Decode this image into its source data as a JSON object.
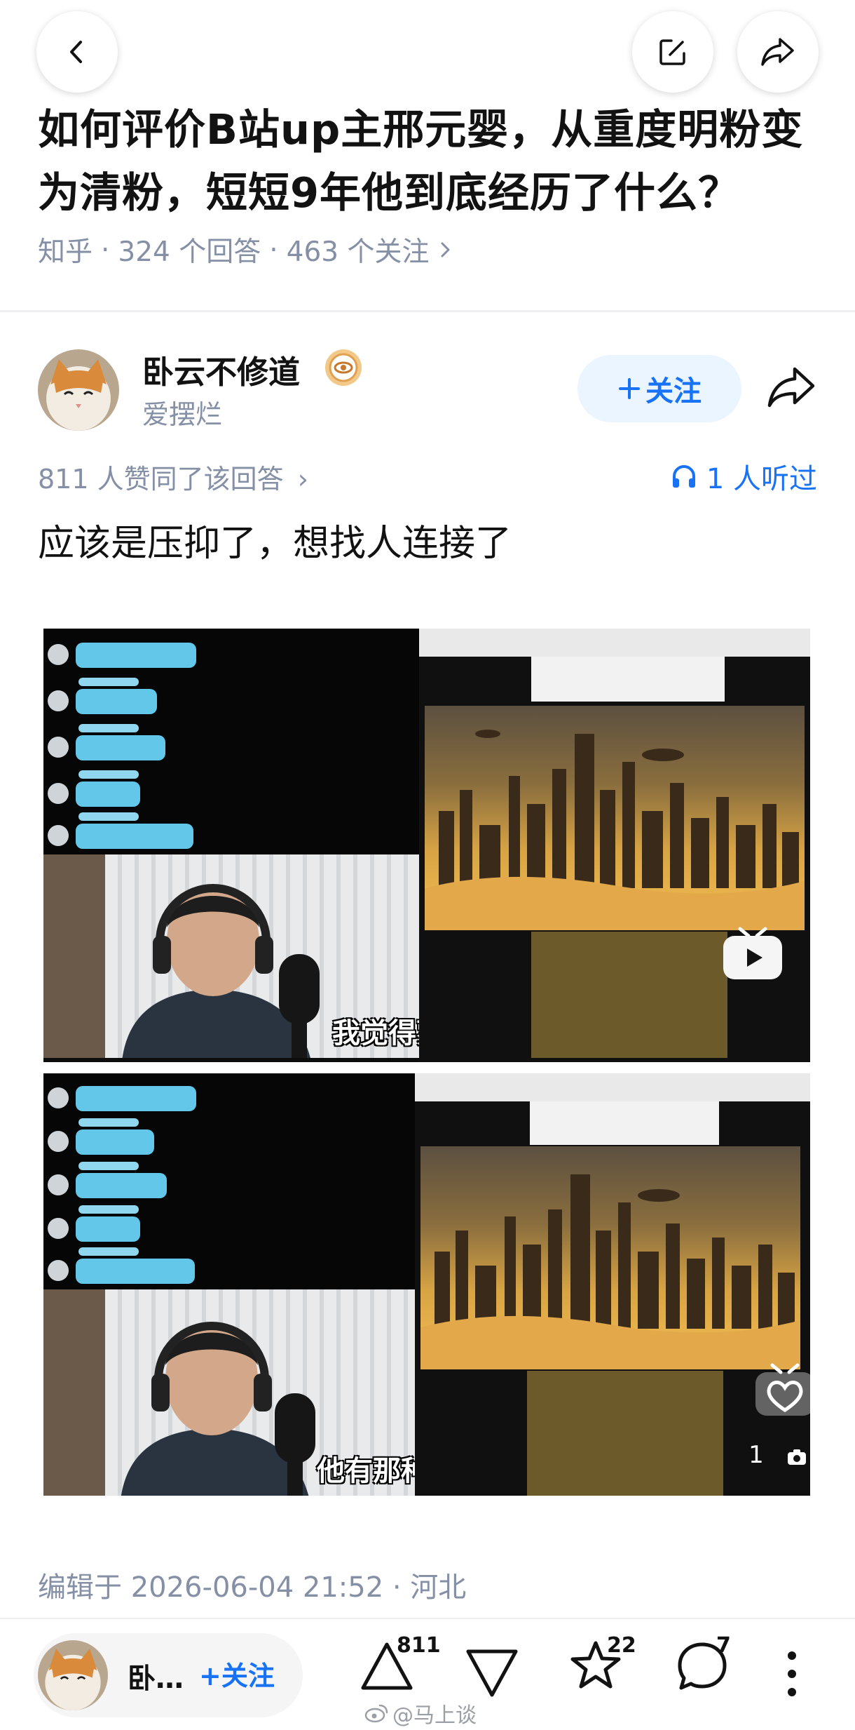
{
  "question": {
    "title": "如何评价B站up主邢元婴，从重度明粉变为清粉，短短9年他到底经历了什么？",
    "source": "知乎",
    "answers_count": "324 个回答",
    "followers_count": "463 个关注",
    "separator": "·"
  },
  "author": {
    "name": "卧云不修道",
    "bio": "爱摆烂",
    "follow_label": "关注",
    "short_name": "卧…"
  },
  "answer": {
    "likes_line": "811 人赞同了该回答",
    "listened": "1 人听过",
    "text": "应该是压抑了，想找人连接了",
    "subtitle_1": "我觉得蒙曼老师",
    "subtitle_2": "他有那种知性的美",
    "image_like_count": "1",
    "edited": "编辑于 2026-06-04 21:52 · 河北"
  },
  "bottom_bar": {
    "upvote_count": "811",
    "favorite_count": "22",
    "comment_count": "7",
    "follow_label": "关注"
  },
  "watermark": "@马上谈",
  "icons": {
    "back": "chevron-left-icon",
    "edit": "edit-icon",
    "share": "share-icon",
    "listen": "headphones-icon",
    "upvote": "triangle-up-icon",
    "downvote": "triangle-down-icon",
    "favorite": "star-icon",
    "comment": "comment-icon",
    "more": "more-vertical-icon"
  },
  "colors": {
    "accent": "#1772f6",
    "meta": "#8590a6",
    "follow_bg": "#ebf5ff"
  }
}
